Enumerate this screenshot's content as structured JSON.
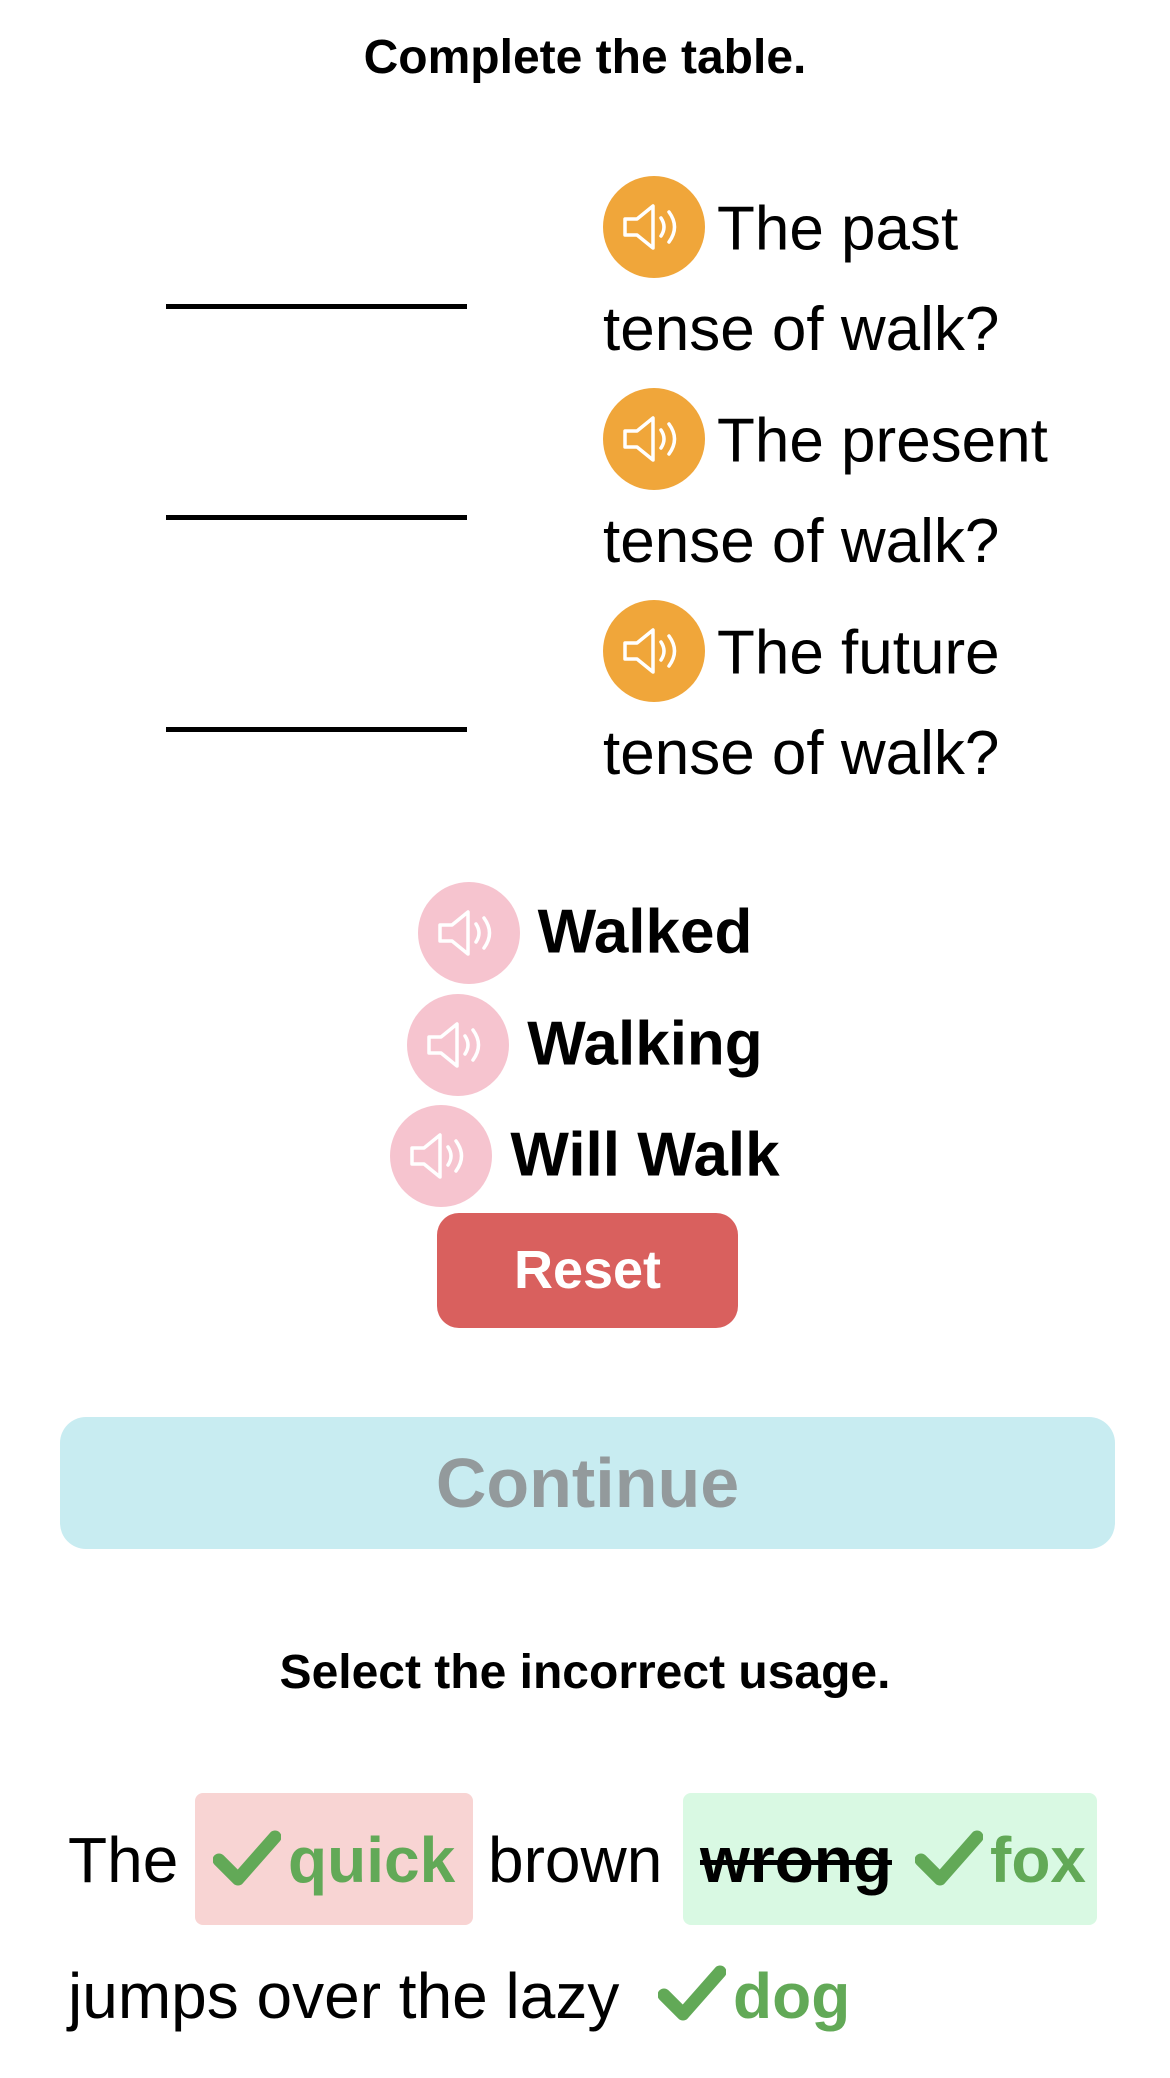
{
  "section1": {
    "title": "Complete the table.",
    "prompts": [
      {
        "first_line": "The past",
        "second_line": "tense of walk?"
      },
      {
        "first_line": "The present",
        "second_line": "tense of walk?"
      },
      {
        "first_line": "The future",
        "second_line": "tense of walk?"
      }
    ],
    "choices": [
      "Walked",
      "Walking",
      "Will Walk"
    ],
    "reset_label": "Reset",
    "continue_label": "Continue"
  },
  "section2": {
    "title": "Select the incorrect usage.",
    "words": {
      "the": "The",
      "quick": "quick",
      "brown": "brown",
      "wrong": "wrong",
      "fox": "fox",
      "line2": "jumps over the lazy",
      "dog": "dog"
    }
  },
  "colors": {
    "speaker_orange": "#f0a63a",
    "speaker_pink": "#f6c4cf",
    "reset": "#d9605e",
    "continue_bg": "#c8ecf1",
    "continue_text": "#939a9c",
    "correct_green": "#62a957",
    "chip_pink": "#f8d4d3",
    "chip_green": "#d9f9e3"
  },
  "icons": [
    "speaker-icon",
    "checkmark-icon"
  ]
}
